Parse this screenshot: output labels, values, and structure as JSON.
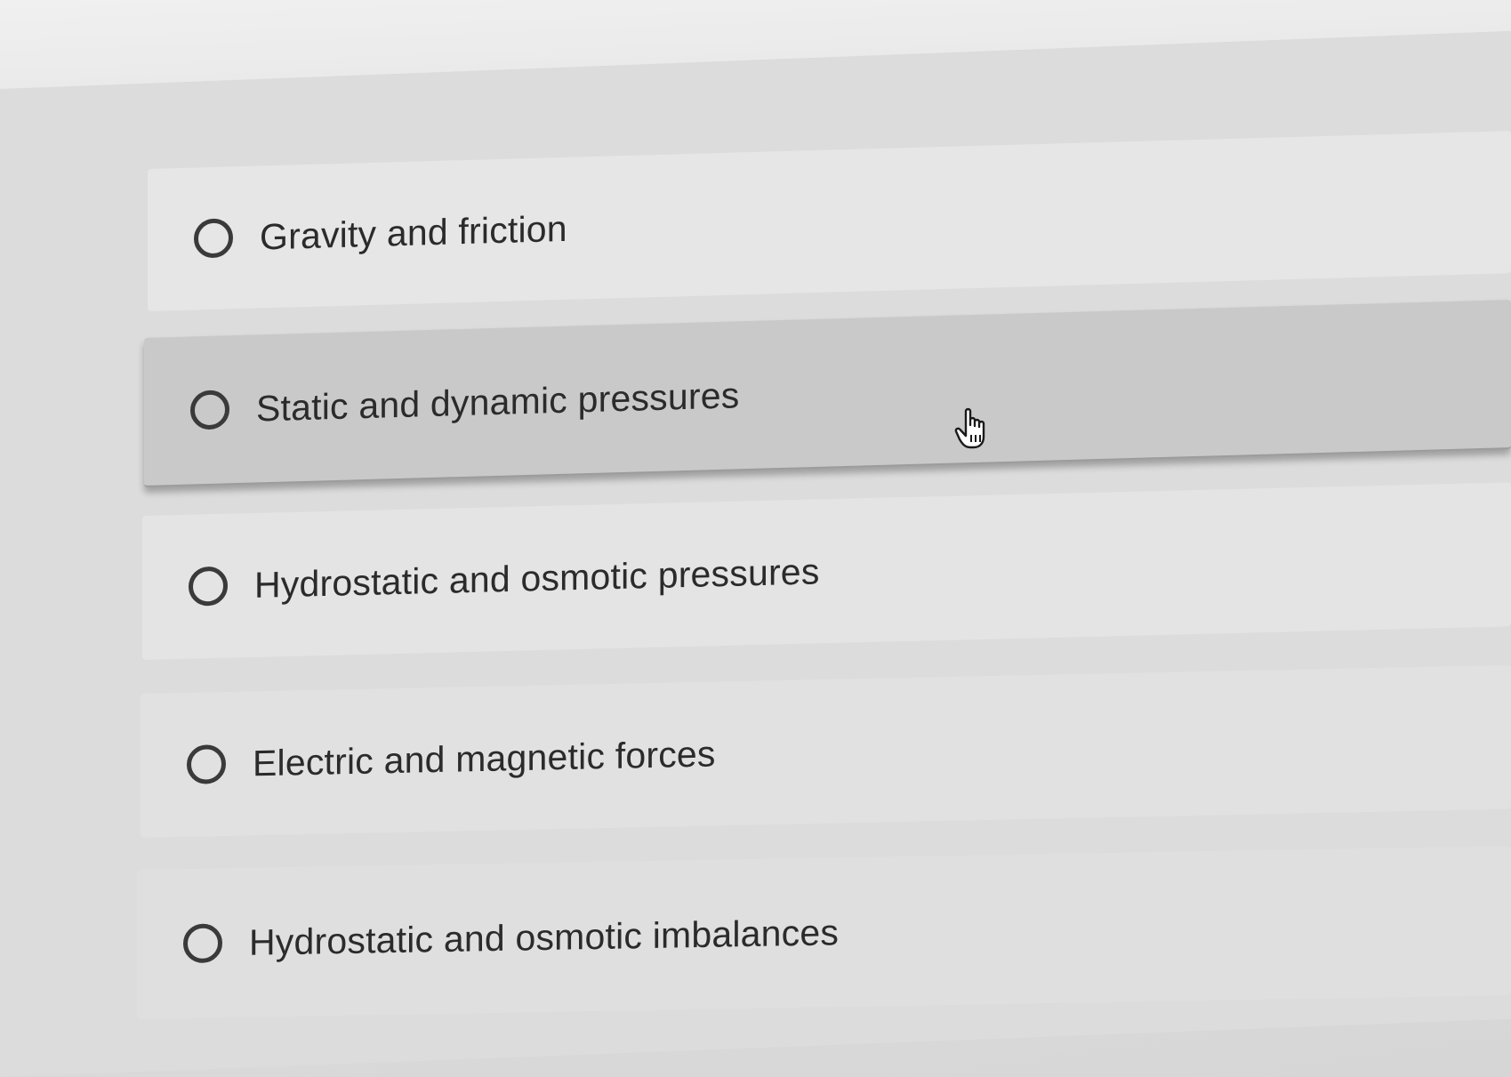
{
  "question": {
    "options": [
      {
        "label": "Gravity and friction",
        "selected": false,
        "hovered": false
      },
      {
        "label": "Static and dynamic pressures",
        "selected": false,
        "hovered": true
      },
      {
        "label": "Hydrostatic and osmotic pressures",
        "selected": false,
        "hovered": false
      },
      {
        "label": "Electric and magnetic forces",
        "selected": false,
        "hovered": false
      },
      {
        "label": "Hydrostatic and osmotic imbalances",
        "selected": false,
        "hovered": false
      }
    ]
  },
  "cursor": {
    "icon": "hand-pointer-icon"
  },
  "colors": {
    "background": "#dcdcdc",
    "option_bg": "#e4e4e4",
    "option_hover_bg": "#c9c9c9",
    "text": "#2b2b2b",
    "radio_border": "#3a3a3a"
  }
}
